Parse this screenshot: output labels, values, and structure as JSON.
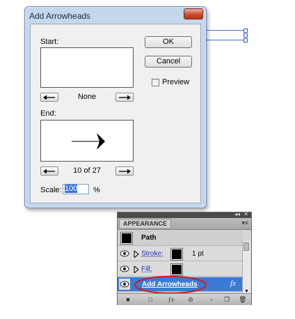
{
  "dialog": {
    "title": "Add Arrowheads",
    "start": {
      "label": "Start:",
      "value": "None"
    },
    "end": {
      "label": "End:",
      "value": "10 of 27"
    },
    "scale": {
      "label": "Scale:",
      "value": "100",
      "unit": "%"
    },
    "ok_label": "OK",
    "cancel_label": "Cancel",
    "preview_label": "Preview"
  },
  "panel": {
    "tab_label": "APPEARANCE",
    "item_title": "Path",
    "rows": [
      {
        "name": "Stroke:",
        "value": "1 pt"
      },
      {
        "name": "Fill:"
      },
      {
        "name": "Add Arrowheads",
        "fx": "fx"
      }
    ],
    "colors": {
      "highlight": "#3a7bd5",
      "annotation": "#cc2222"
    }
  }
}
